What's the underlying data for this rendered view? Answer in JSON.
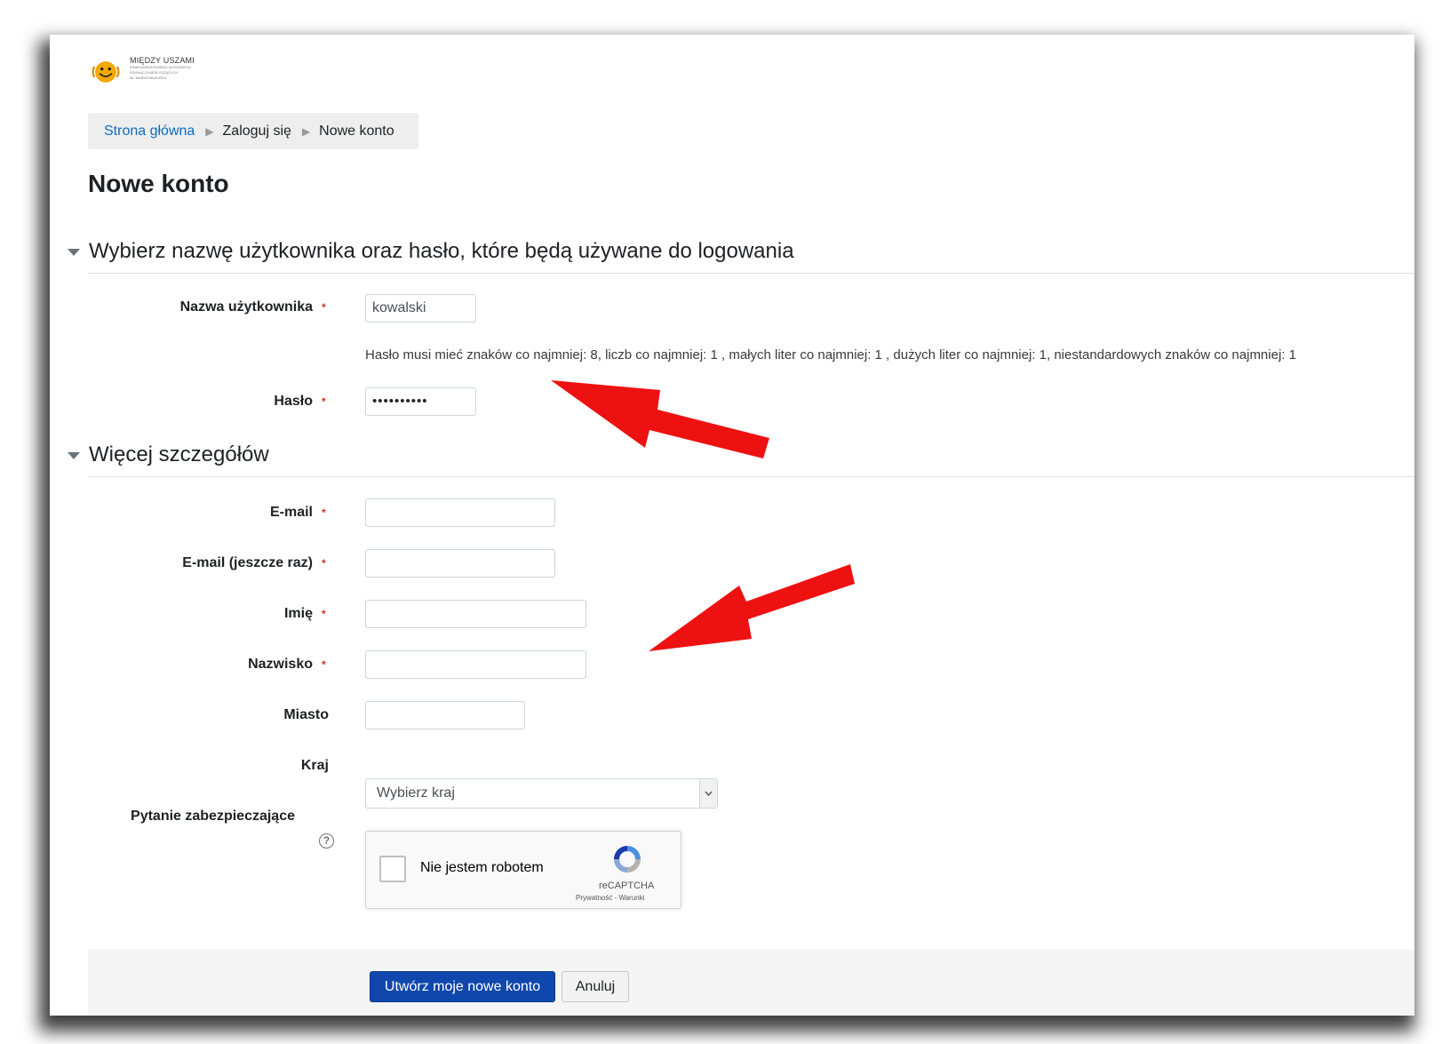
{
  "logo": {
    "title": "MIĘDZY USZAMI",
    "lines": [
      "KRAKOWSKA FUNDACJA ROZWOJU",
      "EDUKACJI NIESŁYSZĄCYCH",
      "IM. MARKA MAZURKA"
    ]
  },
  "breadcrumb": {
    "home": "Strona główna",
    "login": "Zaloguj się",
    "current": "Nowe konto"
  },
  "page_title": "Nowe konto",
  "section1": {
    "title": "Wybierz nazwę użytkownika oraz hasło, które będą używane do logowania",
    "username_label": "Nazwa użytkownika",
    "username_value": "kowalski",
    "password_hint": "Hasło musi mieć znaków co najmniej: 8, liczb co najmniej: 1 , małych liter co najmniej: 1 , dużych liter co najmniej: 1, niestandardowych znaków co najmniej: 1",
    "password_label": "Hasło",
    "password_value": "••••••••••"
  },
  "section2": {
    "title": "Więcej szczegółów",
    "email_label": "E-mail",
    "email2_label": "E-mail (jeszcze raz)",
    "firstname_label": "Imię",
    "lastname_label": "Nazwisko",
    "city_label": "Miasto",
    "country_label": "Kraj",
    "country_value": "Wybierz kraj",
    "captcha_label": "Pytanie zabezpieczające"
  },
  "required_mark": "*",
  "recaptcha": {
    "text": "Nie jestem robotem",
    "brand": "reCAPTCHA",
    "links": "Prywatność - Warunki"
  },
  "buttons": {
    "submit": "Utwórz moje nowe konto",
    "cancel": "Anuluj"
  },
  "colors": {
    "link": "#0f6cbf",
    "required": "#ca3120",
    "primary_button": "#0f47ad",
    "arrow": "#ee1111"
  },
  "icons": {
    "section_toggle": "caret-down-icon",
    "help": "question-circle-icon",
    "select": "chevron-down-icon",
    "captcha": "recaptcha-logo-icon",
    "annotation": "red-arrow-icon"
  }
}
